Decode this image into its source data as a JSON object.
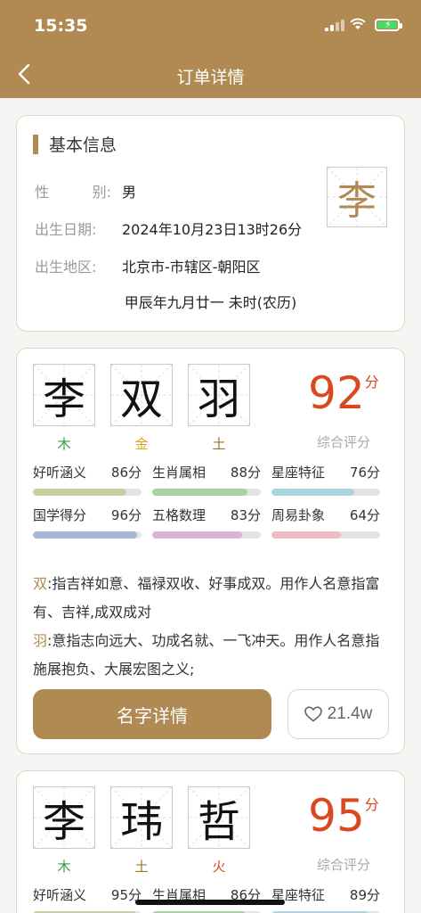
{
  "status": {
    "time": "15:35"
  },
  "nav": {
    "title": "订单详情"
  },
  "info": {
    "header": "基本信息",
    "gender_label_a": "性",
    "gender_label_b": "别:",
    "gender": "男",
    "birth_date_label": "出生日期:",
    "birth_date": "2024年10月23日13时26分",
    "birth_place_label": "出生地区:",
    "birth_place": "北京市-市辖区-朝阳区",
    "lunar": "甲辰年九月廿一 未时(农历)",
    "surname": "李"
  },
  "names": [
    {
      "chars": [
        "李",
        "双",
        "羽"
      ],
      "elements": [
        "木",
        "金",
        "土"
      ],
      "element_colors": [
        "#3a9a3a",
        "#d9a520",
        "#a0702a"
      ],
      "score": "92",
      "score_unit": "分",
      "score_label": "综合评分",
      "metrics": [
        {
          "label": "好听涵义",
          "value": "86分",
          "pct": 0.86,
          "color": "#c7cfa1"
        },
        {
          "label": "生肖属相",
          "value": "88分",
          "pct": 0.88,
          "color": "#a9d1a6"
        },
        {
          "label": "星座特征",
          "value": "76分",
          "pct": 0.76,
          "color": "#aad4df"
        },
        {
          "label": "国学得分",
          "value": "96分",
          "pct": 0.96,
          "color": "#aab5d8"
        },
        {
          "label": "五格数理",
          "value": "83分",
          "pct": 0.83,
          "color": "#d6b5d6"
        },
        {
          "label": "周易卦象",
          "value": "64分",
          "pct": 0.64,
          "color": "#f0b9c6"
        }
      ],
      "desc": [
        {
          "char": "双",
          "text": ":指吉祥如意、福禄双收、好事成双。用作人名意指富有、吉祥,成双成对"
        },
        {
          "char": "羽",
          "text": ":意指志向远大、功成名就、一飞冲天。用作人名意指施展抱负、大展宏图之义;"
        }
      ],
      "detail_button": "名字详情",
      "likes": "21.4w"
    },
    {
      "chars": [
        "李",
        "玮",
        "哲"
      ],
      "elements": [
        "木",
        "土",
        "火"
      ],
      "element_colors": [
        "#3a9a3a",
        "#a0702a",
        "#e0482a"
      ],
      "score": "95",
      "score_unit": "分",
      "score_label": "综合评分",
      "metrics": [
        {
          "label": "好听涵义",
          "value": "95分",
          "pct": 0.95,
          "color": "#c7cfa1"
        },
        {
          "label": "生肖属相",
          "value": "86分",
          "pct": 0.86,
          "color": "#a9d1a6"
        },
        {
          "label": "星座特征",
          "value": "89分",
          "pct": 0.89,
          "color": "#aad4df"
        }
      ]
    }
  ],
  "colors": {
    "brand": "#b08a52",
    "score": "#d9481f"
  }
}
